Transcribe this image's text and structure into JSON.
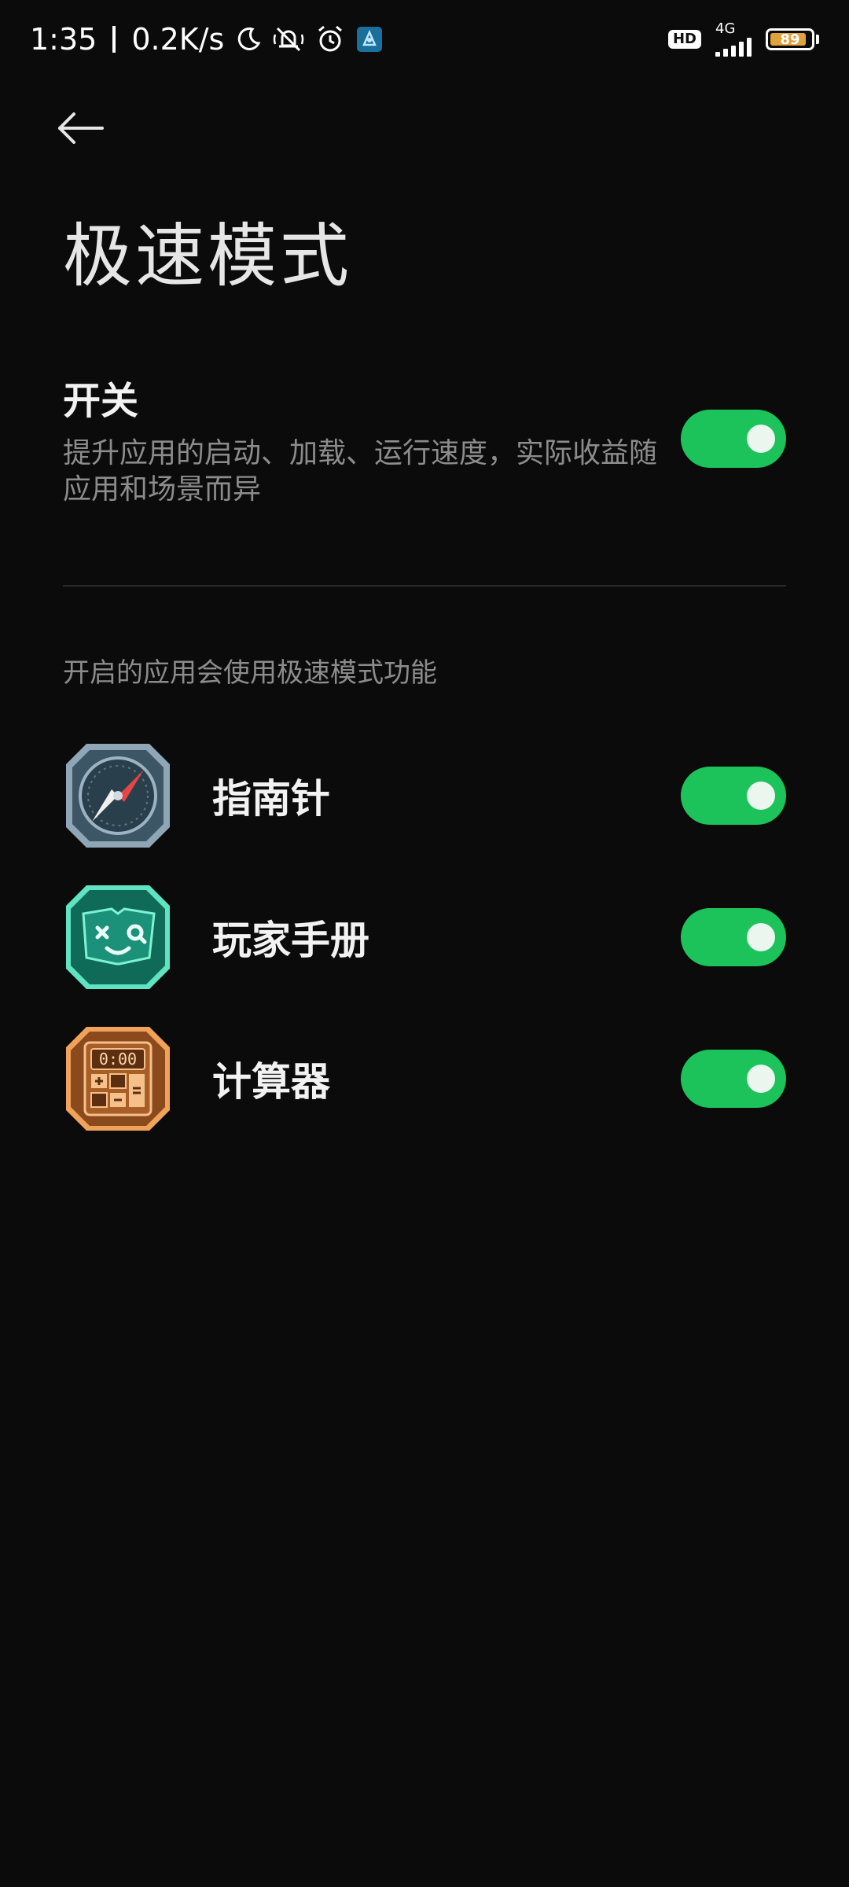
{
  "status_bar": {
    "time": "1:35",
    "net_speed": "0.2K/s",
    "hd_label": "HD",
    "network_type": "4G",
    "battery_level": "89",
    "battery_fraction": 0.89,
    "battery_color": "#e0a23a",
    "icons": [
      "moon-icon",
      "muted-bell-icon",
      "alarm-icon",
      "app-notification-icon"
    ]
  },
  "header": {
    "back_icon": "back-arrow-icon",
    "title": "极速模式"
  },
  "master_switch": {
    "label": "开关",
    "description": "提升应用的启动、加载、运行速度，实际收益随应用和场景而异",
    "enabled": true
  },
  "section": {
    "header": "开启的应用会使用极速模式功能"
  },
  "apps": [
    {
      "name": "指南针",
      "icon": "compass-app-icon",
      "enabled": true
    },
    {
      "name": "玩家手册",
      "icon": "player-handbook-app-icon",
      "enabled": true
    },
    {
      "name": "计算器",
      "icon": "calculator-app-icon",
      "enabled": true
    }
  ],
  "colors": {
    "background": "#0b0b0b",
    "toggle_on": "#1cc35a",
    "secondary_text": "#8c8c8c"
  }
}
